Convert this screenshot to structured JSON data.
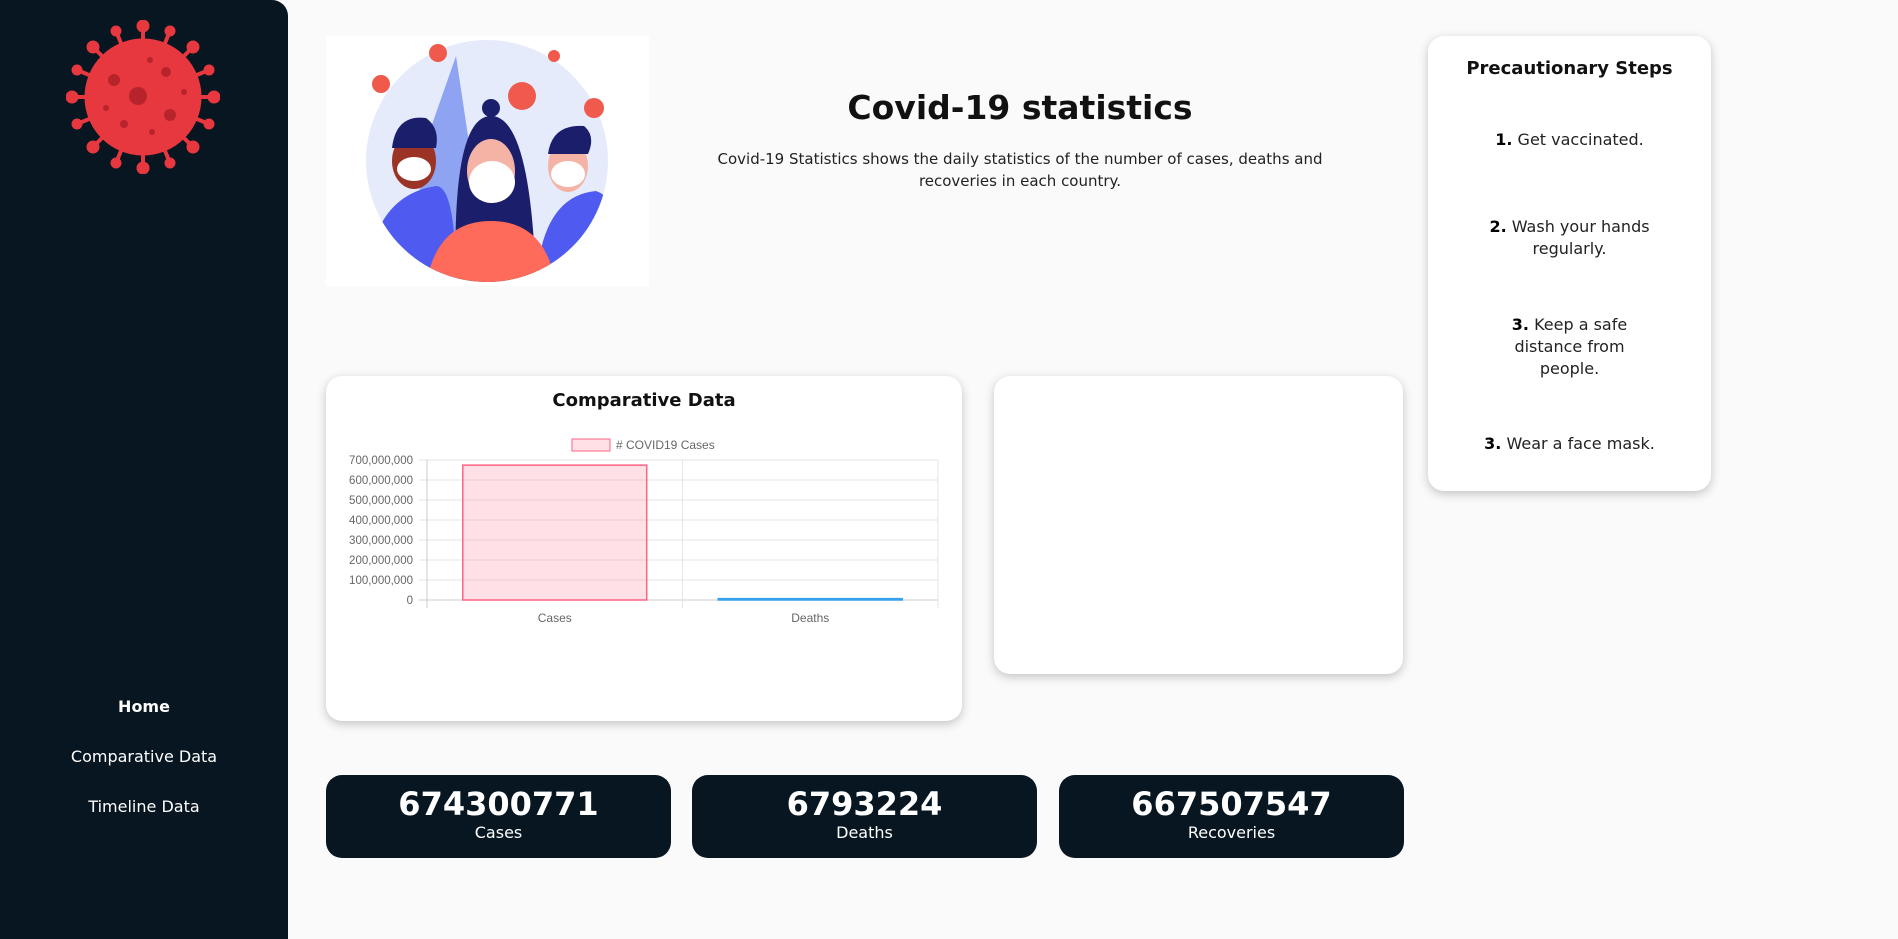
{
  "sidebar": {
    "nav": [
      {
        "label": "Home",
        "active": true
      },
      {
        "label": "Comparative Data",
        "active": false
      },
      {
        "label": "Timeline Data",
        "active": false
      }
    ]
  },
  "header": {
    "title": "Covid-19 statistics",
    "subtitle": "Covid-19 Statistics shows the daily statistics of the number of cases, deaths and recoveries in each country."
  },
  "chart_card": {
    "title": "Comparative Data"
  },
  "chart_data": {
    "type": "bar",
    "legend": "# COVID19 Cases",
    "legend_position": "top",
    "categories": [
      "Cases",
      "Deaths"
    ],
    "values": [
      674300771,
      6793224
    ],
    "ylim": [
      0,
      700000000
    ],
    "yticks": [
      "700,000,000",
      "600,000,000",
      "500,000,000",
      "400,000,000",
      "300,000,000",
      "200,000,000",
      "100,000,000",
      "0"
    ],
    "grid": true,
    "colors": {
      "Cases": "#ff6384",
      "Deaths": "#36a2eb"
    }
  },
  "steps": {
    "title": "Precautionary Steps",
    "items": [
      {
        "num": "1.",
        "text": "Get vaccinated."
      },
      {
        "num": "2.",
        "text": "Wash your hands regularly."
      },
      {
        "num": "3.",
        "text": "Keep a safe distance from people."
      },
      {
        "num": "3.",
        "text": "Wear a face mask."
      }
    ]
  },
  "stats": [
    {
      "value": "674300771",
      "label": "Cases"
    },
    {
      "value": "6793224",
      "label": "Deaths"
    },
    {
      "value": "667507547",
      "label": "Recoveries"
    }
  ],
  "colors": {
    "sidebar": "#071620",
    "virus": "#e8383f"
  }
}
